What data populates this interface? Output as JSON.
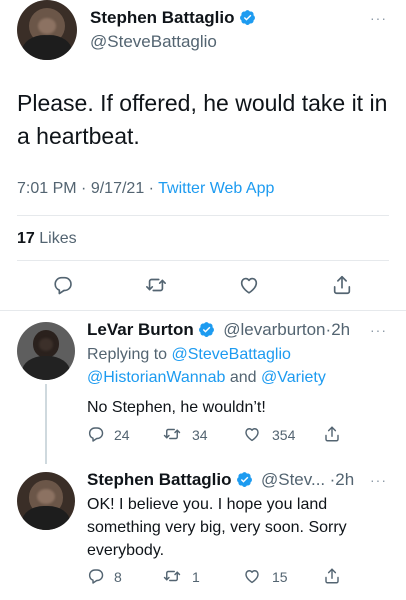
{
  "main_tweet": {
    "author_name": "Stephen Battaglio",
    "author_handle": "@SteveBattaglio",
    "text": "Please. If offered, he would take it in a heartbeat.",
    "time": "7:01 PM",
    "date": "9/17/21",
    "source": "Twitter Web App",
    "likes_count": "17",
    "likes_label": "Likes"
  },
  "reply_1": {
    "author_name": "LeVar Burton",
    "author_handle": "@levarburton",
    "age": "2h",
    "replying_to_prefix": "Replying to",
    "mention_1": "@SteveBattaglio",
    "mention_2": "@HistorianWannab",
    "mention_joiner": "and",
    "mention_3": "@Variety",
    "text": "No Stephen, he wouldn’t!",
    "replies": "24",
    "retweets": "34",
    "likes": "354"
  },
  "reply_2": {
    "author_name": "Stephen Battaglio",
    "author_handle": "@Stev...",
    "age": "2h",
    "text": "OK! I believe you. I hope you land something very big, very soon. Sorry everybody.",
    "replies": "8",
    "retweets": "1",
    "likes": "15"
  },
  "separator": "·",
  "more_glyph": "···",
  "colors": {
    "accent": "#1d9bf0",
    "secondary_text": "#536471",
    "divider": "#e6e9ec"
  },
  "icons": [
    "verified-badge-icon",
    "more-icon",
    "reply-icon",
    "retweet-icon",
    "like-icon",
    "share-icon"
  ]
}
